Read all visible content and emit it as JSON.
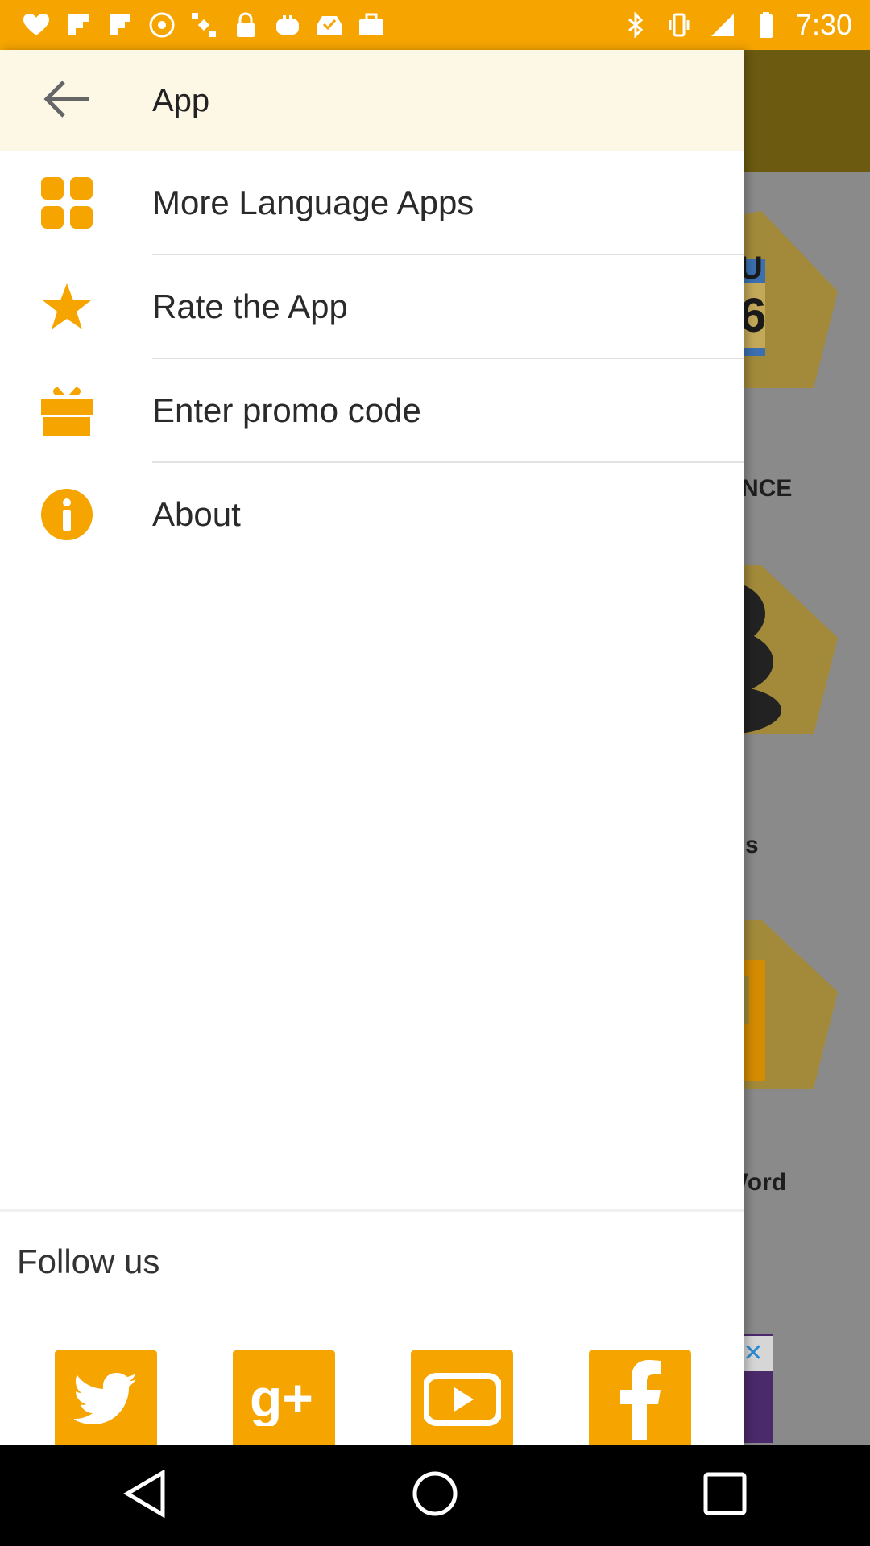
{
  "status_bar": {
    "time": "7:30",
    "icons": [
      "iheart-icon",
      "flipboard-icon",
      "flipboard-icon",
      "radio-icon",
      "satellite-icon",
      "lock-icon",
      "toaster-icon",
      "inbox-icon",
      "briefcase-icon"
    ],
    "right_icons": [
      "bluetooth-icon",
      "vibrate-icon",
      "signal-icon",
      "battery-icon"
    ]
  },
  "drawer": {
    "title": "App",
    "back_icon": "arrow-left-icon",
    "items": [
      {
        "label": "More Language Apps",
        "icon": "apps-grid-icon"
      },
      {
        "label": "Rate the App",
        "icon": "star-icon"
      },
      {
        "label": "Enter promo code",
        "icon": "gift-icon"
      },
      {
        "label": "About",
        "icon": "info-icon"
      }
    ],
    "follow": {
      "label": "Follow us",
      "networks": [
        "twitter-icon",
        "google-plus-icon",
        "youtube-icon",
        "facebook-icon"
      ]
    }
  },
  "background": {
    "labels": [
      "ENCE",
      "als",
      "Word"
    ],
    "calendar_top": "U",
    "calendar_num": "6"
  },
  "colors": {
    "accent": "#f5a400",
    "drawer_header": "#fdf7e6"
  },
  "nav_bar": [
    "back-icon",
    "home-icon",
    "recents-icon"
  ]
}
